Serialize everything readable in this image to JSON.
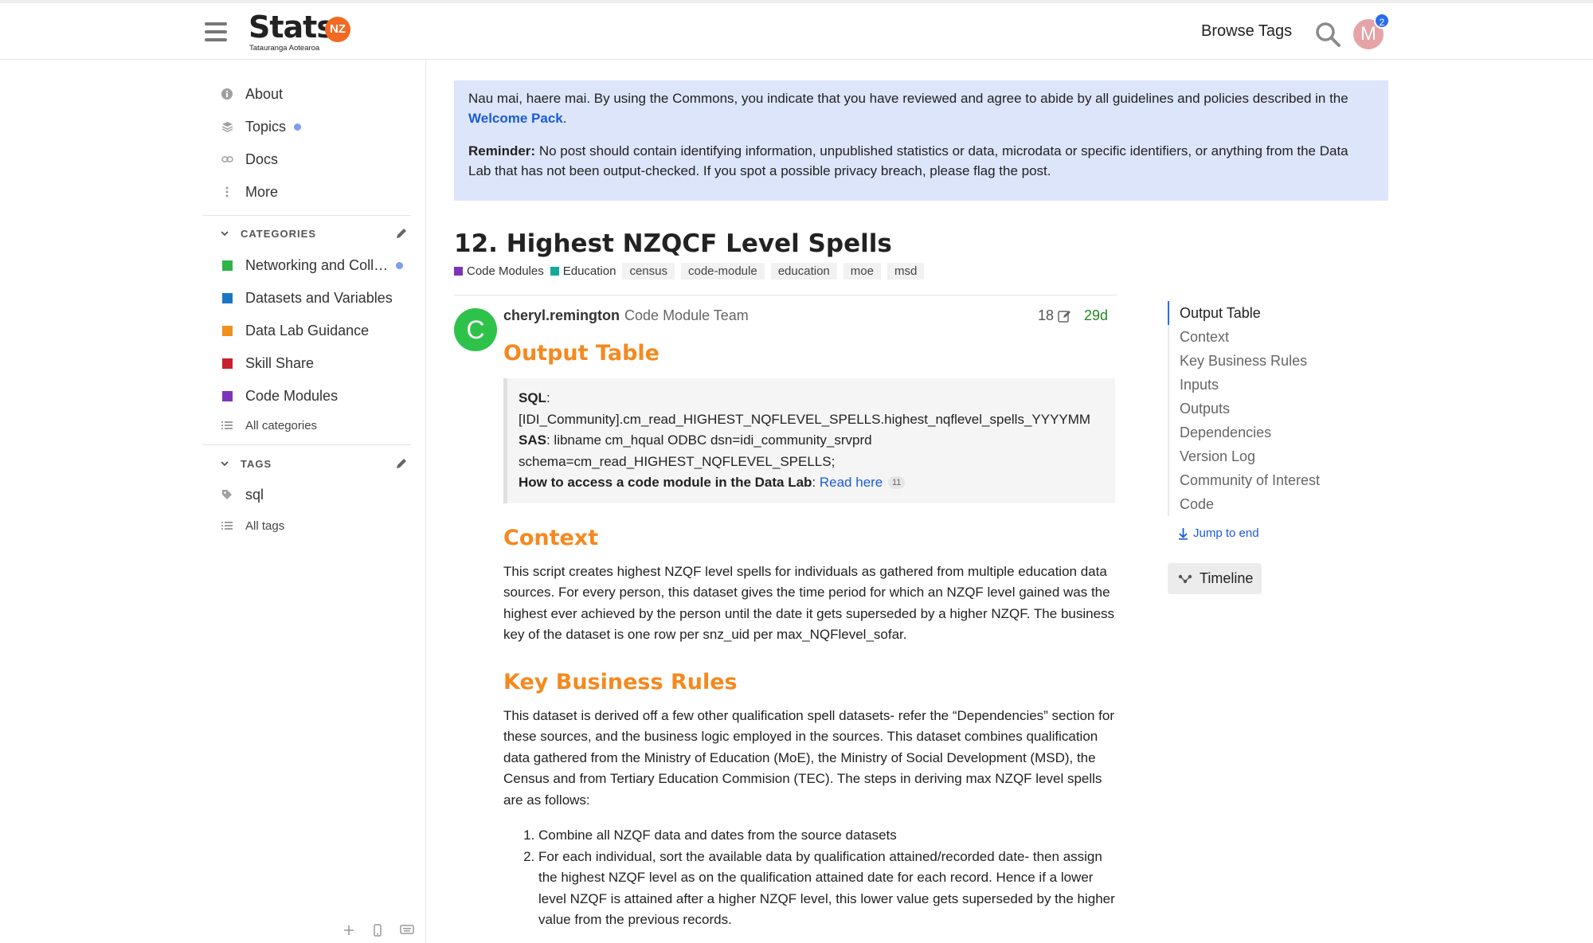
{
  "header": {
    "logo_word": "Stats",
    "logo_badge": "NZ",
    "logo_subtitle": "Tatauranga Aotearoa",
    "browse_tags": "Browse Tags",
    "avatar_letter": "M",
    "notification_count": "2"
  },
  "sidebar": {
    "nav": [
      {
        "label": "About",
        "icon": "info-icon"
      },
      {
        "label": "Topics",
        "icon": "layers-icon"
      },
      {
        "label": "Docs",
        "icon": "link-icon"
      },
      {
        "label": "More",
        "icon": "vertical-dots-icon"
      }
    ],
    "categories_title": "CATEGORIES",
    "categories": [
      {
        "label": "Networking and Coll…",
        "color": "#2fb34a"
      },
      {
        "label": "Datasets and Variables",
        "color": "#1b75c4"
      },
      {
        "label": "Data Lab Guidance",
        "color": "#f0901f"
      },
      {
        "label": "Skill Share",
        "color": "#c8202f"
      },
      {
        "label": "Code Modules",
        "color": "#7c35b8"
      }
    ],
    "all_categories": "All categories",
    "tags_title": "TAGS",
    "tags": [
      {
        "label": "sql"
      }
    ],
    "all_tags": "All tags"
  },
  "banner": {
    "intro": "Nau mai, haere mai. By using the Commons, you indicate that you have reviewed and agree to abide by all guidelines and policies described in the",
    "link": "Welcome Pack",
    "intro_end": ".",
    "reminder_label": "Reminder:",
    "reminder_text": "No post should contain identifying information, unpublished statistics or data, microdata or specific identifiers, or anything from the Data Lab that has not been output-checked. If you spot a possible privacy breach, please flag the post."
  },
  "topic": {
    "title": "12. Highest NZQCF Level Spells",
    "categories": [
      {
        "label": "Code Modules",
        "color": "#7c35b8"
      },
      {
        "label": "Education",
        "color": "#12a89d"
      }
    ],
    "tags": [
      "census",
      "code-module",
      "education",
      "moe",
      "msd"
    ]
  },
  "post": {
    "avatar_letter": "C",
    "avatar_color": "#2fc24a",
    "username": "cheryl.remington",
    "user_title": "Code Module Team",
    "edit_count": "18",
    "age": "29d",
    "output_heading": "Output Table",
    "sql_label": "SQL",
    "sql_value": "[IDI_Community].cm_read_HIGHEST_NQFLEVEL_SPELLS.highest_nqflevel_spells_YYYYMM",
    "sas_label": "SAS",
    "sas_value": "libname cm_hqual ODBC dsn=idi_community_srvprd schema=cm_read_HIGHEST_NQFLEVEL_SPELLS;",
    "access_label": "How to access a code module in the Data Lab",
    "access_link": "Read here",
    "access_clicks": "11",
    "context_heading": "Context",
    "context_text": "This script creates highest NZQF level spells for individuals as gathered from multiple education data sources. For every person, this dataset gives the time period for which an NZQF level gained was the highest ever achieved by the person until the date it gets superseded by a higher NZQF. The business key of the dataset is one row per snz_uid per max_NQFlevel_sofar.",
    "rules_heading": "Key Business Rules",
    "rules_text": "This dataset is derived off a few other qualification spell datasets- refer the “Dependencies” section for these sources, and the business logic employed in the sources. This dataset combines qualification data gathered from the Ministry of Education (MoE), the Ministry of Social Development (MSD), the Census and from Tertiary Education Commision (TEC). The steps in deriving max NZQF level spells are as follows:",
    "steps": [
      "Combine all NZQF data and dates from the source datasets",
      "For each individual, sort the available data by qualification attained/recorded date- then assign the highest NZQF level as on the qualification attained date for each record. Hence if a lower level NZQF is attained after a higher NZQF level, this lower value gets superseded by the higher value from the previous records."
    ]
  },
  "toc": {
    "items": [
      "Output Table",
      "Context",
      "Key Business Rules",
      "Inputs",
      "Outputs",
      "Dependencies",
      "Version Log",
      "Community of Interest",
      "Code"
    ],
    "jump": "Jump to end",
    "timeline": "Timeline"
  },
  "colors": {
    "heading_orange": "#f5891f",
    "link_blue": "#1a5bd6",
    "banner_bg": "#dde5fb",
    "accent_blue": "#2a6cf0"
  }
}
